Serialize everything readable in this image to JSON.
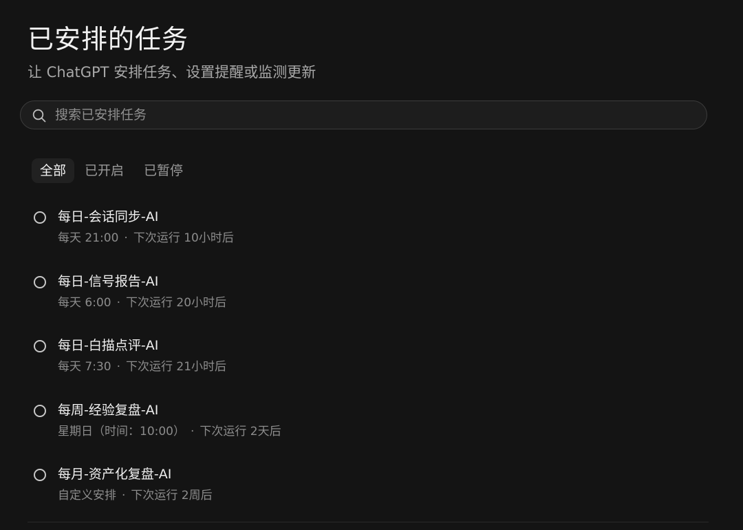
{
  "header": {
    "title": "已安排的任务",
    "subtitle": "让 ChatGPT 安排任务、设置提醒或监测更新"
  },
  "search": {
    "placeholder": "搜索已安排任务",
    "value": "",
    "icon": "search-icon"
  },
  "tabs": [
    {
      "label": "全部",
      "active": true
    },
    {
      "label": "已开启",
      "active": false
    },
    {
      "label": "已暂停",
      "active": false
    }
  ],
  "tasks": [
    {
      "name": "每日-会话同步-AI",
      "schedule": "每天 21:00",
      "separator": "·",
      "next_run": "下次运行 10小时后"
    },
    {
      "name": "每日-信号报告-AI",
      "schedule": "每天 6:00",
      "separator": "·",
      "next_run": "下次运行 20小时后"
    },
    {
      "name": "每日-白描点评-AI",
      "schedule": "每天 7:30",
      "separator": "·",
      "next_run": "下次运行 21小时后"
    },
    {
      "name": "每周-经验复盘-AI",
      "schedule": "星期日（时间：10:00）",
      "separator": "·",
      "next_run": "下次运行 2天后"
    },
    {
      "name": "每月-资产化复盘-AI",
      "schedule": "自定义安排",
      "separator": "·",
      "next_run": "下次运行 2周后"
    }
  ]
}
